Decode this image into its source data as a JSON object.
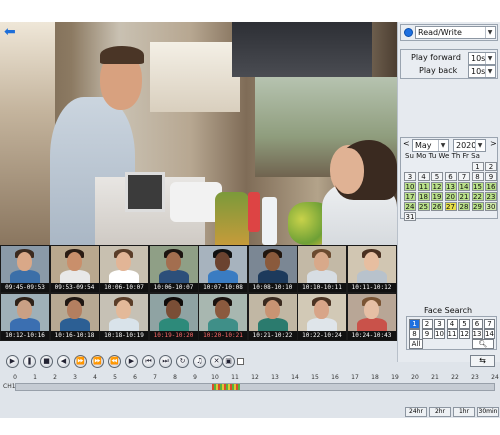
{
  "right_panel": {
    "mode": "Read/Write",
    "play_forward_label": "Play forward",
    "play_forward_value": "10s",
    "play_back_label": "Play back",
    "play_back_value": "10s"
  },
  "calendar": {
    "month": "May",
    "year": "2020",
    "weekdays": "Su Mo Tu We Th Fr Sa",
    "prev": "<",
    "next": ">",
    "days": [
      "1",
      "2",
      "3",
      "4",
      "5",
      "6",
      "7",
      "8",
      "9",
      "10",
      "11",
      "12",
      "13",
      "14",
      "15",
      "16",
      "17",
      "18",
      "19",
      "20",
      "21",
      "22",
      "23",
      "24",
      "25",
      "26",
      "27",
      "28",
      "29",
      "30",
      "31"
    ],
    "recorded_days": [
      "10",
      "11",
      "12",
      "13",
      "14",
      "15",
      "16",
      "17",
      "18",
      "19",
      "20",
      "21",
      "22",
      "23",
      "24",
      "25",
      "26",
      "28",
      "29",
      "30"
    ],
    "highlight_today": "27",
    "selected_day": "30"
  },
  "face_search": {
    "title": "Face Search",
    "numbers": [
      "1",
      "2",
      "3",
      "4",
      "5",
      "6",
      "7",
      "8",
      "9",
      "10",
      "11",
      "12",
      "13",
      "14"
    ],
    "active": "1",
    "all_label": "All",
    "search_icon": "magnifier-icon"
  },
  "thumbnails": [
    {
      "time": "09:45-09:53"
    },
    {
      "time": "09:53-09:54"
    },
    {
      "time": "10:06-10:07"
    },
    {
      "time": "10:06-10:07"
    },
    {
      "time": "10:07-10:08"
    },
    {
      "time": "10:08-10:10"
    },
    {
      "time": "10:10-10:11"
    },
    {
      "time": "10:11-10:12"
    },
    {
      "time": "10:12-10:16"
    },
    {
      "time": "10:16-10:18"
    },
    {
      "time": "10:18-10:19"
    },
    {
      "time": "10:19-10:20"
    },
    {
      "time": "10:20-10:21"
    },
    {
      "time": "10:21-10:22"
    },
    {
      "time": "10:22-10:24"
    },
    {
      "time": "10:24-10:43"
    }
  ],
  "timeline": {
    "channel": "CH1",
    "ticks": [
      "0",
      "1",
      "2",
      "3",
      "4",
      "5",
      "6",
      "7",
      "8",
      "9",
      "10",
      "11",
      "12",
      "13",
      "14",
      "15",
      "16",
      "17",
      "18",
      "19",
      "20",
      "21",
      "22",
      "23",
      "24"
    ],
    "ranges": [
      "24hr",
      "2hr",
      "1hr",
      "30min"
    ]
  },
  "colors": {
    "accent": "#1e70e0",
    "highlight": "#e7e04a",
    "recorded": "#b9e08a"
  }
}
